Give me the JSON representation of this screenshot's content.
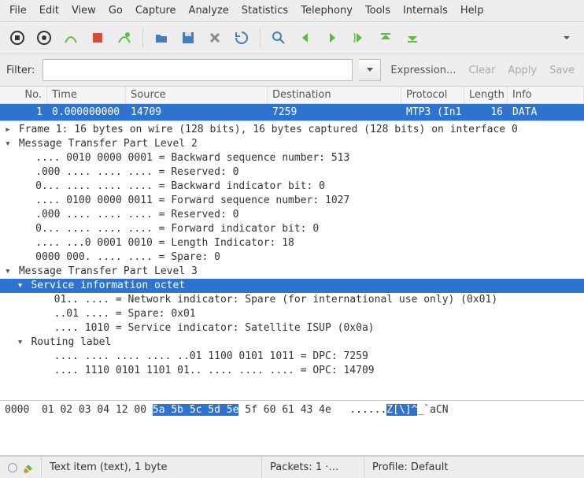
{
  "menu": [
    "File",
    "Edit",
    "View",
    "Go",
    "Capture",
    "Analyze",
    "Statistics",
    "Telephony",
    "Tools",
    "Internals",
    "Help"
  ],
  "filter": {
    "label": "Filter:",
    "value": "",
    "expression": "Expression...",
    "clear": "Clear",
    "apply": "Apply",
    "save": "Save"
  },
  "columns": {
    "no": "No.",
    "time": "Time",
    "src": "Source",
    "dst": "Destination",
    "proto": "Protocol",
    "len": "Length",
    "info": "Info"
  },
  "packet": {
    "no": "1",
    "time": "0.000000000",
    "src": "14709",
    "dst": "7259",
    "proto": "MTP3 (In1",
    "len": "16",
    "info": "DATA"
  },
  "details": {
    "frame": "Frame 1: 16 bytes on wire (128 bits), 16 bytes captured (128 bits) on interface 0",
    "mtp2": "Message Transfer Part Level 2",
    "mtp2_lines": [
      ".... 0010 0000 0001 = Backward sequence number: 513",
      ".000 .... .... .... = Reserved: 0",
      "0... .... .... .... = Backward indicator bit: 0",
      ".... 0100 0000 0011 = Forward sequence number: 1027",
      ".000 .... .... .... = Reserved: 0",
      "0... .... .... .... = Forward indicator bit: 0",
      ".... ...0 0001 0010 = Length Indicator: 18",
      "0000 000. .... .... = Spare: 0"
    ],
    "mtp3": "Message Transfer Part Level 3",
    "sio": "Service information octet",
    "sio_lines": [
      "01.. .... = Network indicator: Spare (for international use only) (0x01)",
      "..01 .... = Spare: 0x01",
      ".... 1010 = Service indicator: Satellite ISUP (0x0a)"
    ],
    "routing": "Routing label",
    "routing_lines": [
      ".... .... .... .... ..01 1100 0101 1011 = DPC: 7259",
      ".... 1110 0101 1101 01.. .... .... .... = OPC: 14709"
    ]
  },
  "hex": {
    "offset": "0000",
    "pre": "01 02 03 04 12 00 ",
    "sel": "5a 5b 5c 5d 5e",
    "post": " 5f 60 61 43 4e   ",
    "ascii_pre": "......",
    "ascii_sel": "Z[\\]^",
    "ascii_post": "_`aCN"
  },
  "status": {
    "text_item": "Text item (text), 1 byte",
    "packets": "Packets: 1 ·…",
    "profile": "Profile: Default"
  }
}
